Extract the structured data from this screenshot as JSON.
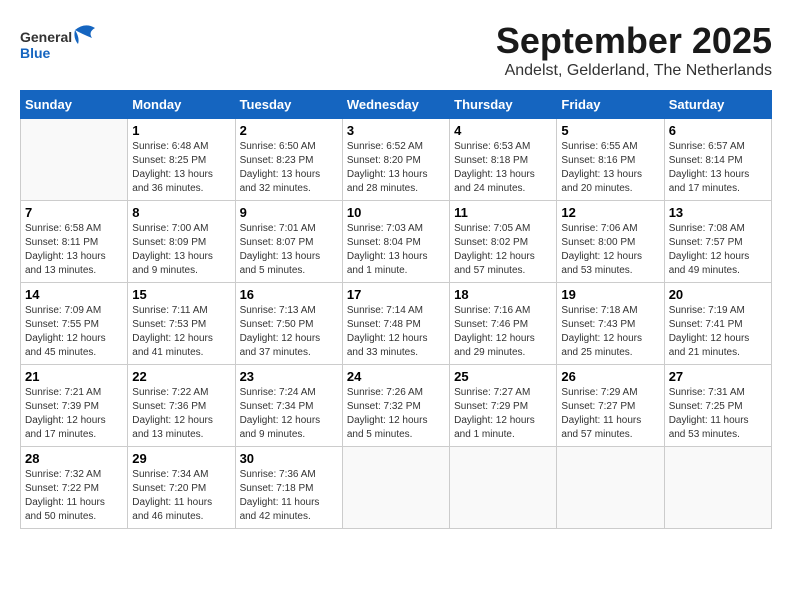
{
  "logo": {
    "general": "General",
    "blue": "Blue"
  },
  "title": "September 2025",
  "location": "Andelst, Gelderland, The Netherlands",
  "weekdays": [
    "Sunday",
    "Monday",
    "Tuesday",
    "Wednesday",
    "Thursday",
    "Friday",
    "Saturday"
  ],
  "weeks": [
    [
      {
        "day": "",
        "info": ""
      },
      {
        "day": "1",
        "info": "Sunrise: 6:48 AM\nSunset: 8:25 PM\nDaylight: 13 hours\nand 36 minutes."
      },
      {
        "day": "2",
        "info": "Sunrise: 6:50 AM\nSunset: 8:23 PM\nDaylight: 13 hours\nand 32 minutes."
      },
      {
        "day": "3",
        "info": "Sunrise: 6:52 AM\nSunset: 8:20 PM\nDaylight: 13 hours\nand 28 minutes."
      },
      {
        "day": "4",
        "info": "Sunrise: 6:53 AM\nSunset: 8:18 PM\nDaylight: 13 hours\nand 24 minutes."
      },
      {
        "day": "5",
        "info": "Sunrise: 6:55 AM\nSunset: 8:16 PM\nDaylight: 13 hours\nand 20 minutes."
      },
      {
        "day": "6",
        "info": "Sunrise: 6:57 AM\nSunset: 8:14 PM\nDaylight: 13 hours\nand 17 minutes."
      }
    ],
    [
      {
        "day": "7",
        "info": "Sunrise: 6:58 AM\nSunset: 8:11 PM\nDaylight: 13 hours\nand 13 minutes."
      },
      {
        "day": "8",
        "info": "Sunrise: 7:00 AM\nSunset: 8:09 PM\nDaylight: 13 hours\nand 9 minutes."
      },
      {
        "day": "9",
        "info": "Sunrise: 7:01 AM\nSunset: 8:07 PM\nDaylight: 13 hours\nand 5 minutes."
      },
      {
        "day": "10",
        "info": "Sunrise: 7:03 AM\nSunset: 8:04 PM\nDaylight: 13 hours\nand 1 minute."
      },
      {
        "day": "11",
        "info": "Sunrise: 7:05 AM\nSunset: 8:02 PM\nDaylight: 12 hours\nand 57 minutes."
      },
      {
        "day": "12",
        "info": "Sunrise: 7:06 AM\nSunset: 8:00 PM\nDaylight: 12 hours\nand 53 minutes."
      },
      {
        "day": "13",
        "info": "Sunrise: 7:08 AM\nSunset: 7:57 PM\nDaylight: 12 hours\nand 49 minutes."
      }
    ],
    [
      {
        "day": "14",
        "info": "Sunrise: 7:09 AM\nSunset: 7:55 PM\nDaylight: 12 hours\nand 45 minutes."
      },
      {
        "day": "15",
        "info": "Sunrise: 7:11 AM\nSunset: 7:53 PM\nDaylight: 12 hours\nand 41 minutes."
      },
      {
        "day": "16",
        "info": "Sunrise: 7:13 AM\nSunset: 7:50 PM\nDaylight: 12 hours\nand 37 minutes."
      },
      {
        "day": "17",
        "info": "Sunrise: 7:14 AM\nSunset: 7:48 PM\nDaylight: 12 hours\nand 33 minutes."
      },
      {
        "day": "18",
        "info": "Sunrise: 7:16 AM\nSunset: 7:46 PM\nDaylight: 12 hours\nand 29 minutes."
      },
      {
        "day": "19",
        "info": "Sunrise: 7:18 AM\nSunset: 7:43 PM\nDaylight: 12 hours\nand 25 minutes."
      },
      {
        "day": "20",
        "info": "Sunrise: 7:19 AM\nSunset: 7:41 PM\nDaylight: 12 hours\nand 21 minutes."
      }
    ],
    [
      {
        "day": "21",
        "info": "Sunrise: 7:21 AM\nSunset: 7:39 PM\nDaylight: 12 hours\nand 17 minutes."
      },
      {
        "day": "22",
        "info": "Sunrise: 7:22 AM\nSunset: 7:36 PM\nDaylight: 12 hours\nand 13 minutes."
      },
      {
        "day": "23",
        "info": "Sunrise: 7:24 AM\nSunset: 7:34 PM\nDaylight: 12 hours\nand 9 minutes."
      },
      {
        "day": "24",
        "info": "Sunrise: 7:26 AM\nSunset: 7:32 PM\nDaylight: 12 hours\nand 5 minutes."
      },
      {
        "day": "25",
        "info": "Sunrise: 7:27 AM\nSunset: 7:29 PM\nDaylight: 12 hours\nand 1 minute."
      },
      {
        "day": "26",
        "info": "Sunrise: 7:29 AM\nSunset: 7:27 PM\nDaylight: 11 hours\nand 57 minutes."
      },
      {
        "day": "27",
        "info": "Sunrise: 7:31 AM\nSunset: 7:25 PM\nDaylight: 11 hours\nand 53 minutes."
      }
    ],
    [
      {
        "day": "28",
        "info": "Sunrise: 7:32 AM\nSunset: 7:22 PM\nDaylight: 11 hours\nand 50 minutes."
      },
      {
        "day": "29",
        "info": "Sunrise: 7:34 AM\nSunset: 7:20 PM\nDaylight: 11 hours\nand 46 minutes."
      },
      {
        "day": "30",
        "info": "Sunrise: 7:36 AM\nSunset: 7:18 PM\nDaylight: 11 hours\nand 42 minutes."
      },
      {
        "day": "",
        "info": ""
      },
      {
        "day": "",
        "info": ""
      },
      {
        "day": "",
        "info": ""
      },
      {
        "day": "",
        "info": ""
      }
    ]
  ]
}
